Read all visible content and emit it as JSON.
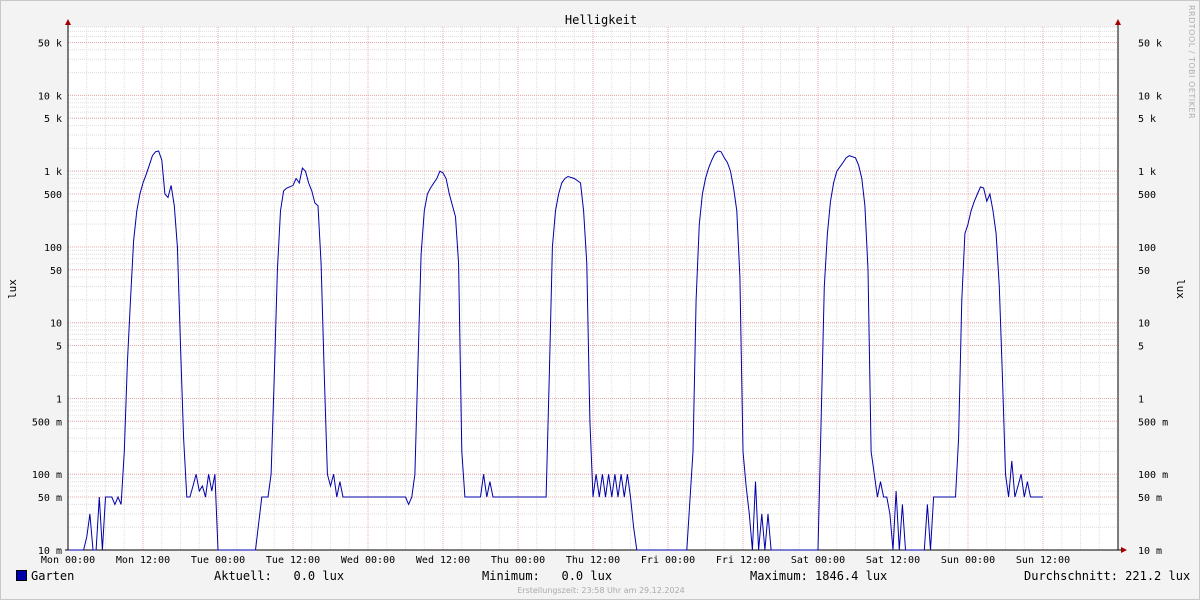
{
  "chart_data": {
    "type": "line",
    "title": "Helligkeit",
    "ylabel": "lux",
    "y_scale": "log",
    "ylim": [
      0.01,
      80000
    ],
    "y_ticks": [
      {
        "value": 0.01,
        "label": "10 m"
      },
      {
        "value": 0.05,
        "label": "50 m"
      },
      {
        "value": 0.1,
        "label": "100 m"
      },
      {
        "value": 0.5,
        "label": "500 m"
      },
      {
        "value": 1,
        "label": "1"
      },
      {
        "value": 5,
        "label": "5"
      },
      {
        "value": 10,
        "label": "10"
      },
      {
        "value": 50,
        "label": "50"
      },
      {
        "value": 100,
        "label": "100"
      },
      {
        "value": 500,
        "label": "500"
      },
      {
        "value": 1000,
        "label": "1 k"
      },
      {
        "value": 5000,
        "label": "5 k"
      },
      {
        "value": 10000,
        "label": "10 k"
      },
      {
        "value": 50000,
        "label": "50 k"
      }
    ],
    "x_ticks": [
      "Mon 00:00",
      "Mon 12:00",
      "Tue 00:00",
      "Tue 12:00",
      "Wed 00:00",
      "Wed 12:00",
      "Thu 00:00",
      "Thu 12:00",
      "Fri 00:00",
      "Fri 12:00",
      "Sat 00:00",
      "Sat 12:00",
      "Sun 00:00",
      "Sun 12:00"
    ],
    "x_unit": "hours since Mon 00:00",
    "xlim": [
      0,
      168
    ],
    "grid": true,
    "series": [
      {
        "name": "Garten",
        "color": "#0000aa",
        "points": [
          [
            0,
            0.01
          ],
          [
            1,
            0.01
          ],
          [
            2.5,
            0.01
          ],
          [
            3,
            0.015
          ],
          [
            3.5,
            0.03
          ],
          [
            4,
            0.01
          ],
          [
            4.5,
            0.01
          ],
          [
            5,
            0.05
          ],
          [
            5.5,
            0.01
          ],
          [
            6,
            0.05
          ],
          [
            7,
            0.05
          ],
          [
            7.5,
            0.04
          ],
          [
            8,
            0.05
          ],
          [
            8.5,
            0.04
          ],
          [
            9,
            0.2
          ],
          [
            9.5,
            3
          ],
          [
            10,
            20
          ],
          [
            10.5,
            120
          ],
          [
            11,
            300
          ],
          [
            11.5,
            500
          ],
          [
            12,
            700
          ],
          [
            12.5,
            900
          ],
          [
            13,
            1200
          ],
          [
            13.5,
            1600
          ],
          [
            14,
            1800
          ],
          [
            14.5,
            1846
          ],
          [
            15,
            1400
          ],
          [
            15.5,
            500
          ],
          [
            16,
            450
          ],
          [
            16.5,
            650
          ],
          [
            17,
            350
          ],
          [
            17.5,
            100
          ],
          [
            18,
            5
          ],
          [
            18.5,
            0.3
          ],
          [
            19,
            0.05
          ],
          [
            19.5,
            0.05
          ],
          [
            20,
            0.07
          ],
          [
            20.5,
            0.1
          ],
          [
            21,
            0.06
          ],
          [
            21.5,
            0.07
          ],
          [
            22,
            0.05
          ],
          [
            22.5,
            0.1
          ],
          [
            23,
            0.06
          ],
          [
            23.5,
            0.1
          ],
          [
            24,
            0.01
          ],
          [
            30,
            0.01
          ],
          [
            31,
            0.05
          ],
          [
            32,
            0.05
          ],
          [
            32.5,
            0.1
          ],
          [
            33,
            2
          ],
          [
            33.5,
            50
          ],
          [
            34,
            300
          ],
          [
            34.5,
            550
          ],
          [
            35,
            600
          ],
          [
            36,
            650
          ],
          [
            36.5,
            800
          ],
          [
            37,
            700
          ],
          [
            37.5,
            1100
          ],
          [
            38,
            1000
          ],
          [
            38.5,
            700
          ],
          [
            39,
            550
          ],
          [
            39.5,
            380
          ],
          [
            40,
            350
          ],
          [
            40.5,
            60
          ],
          [
            41,
            2
          ],
          [
            41.5,
            0.1
          ],
          [
            42,
            0.07
          ],
          [
            42.5,
            0.1
          ],
          [
            43,
            0.05
          ],
          [
            43.5,
            0.08
          ],
          [
            44,
            0.05
          ],
          [
            50,
            0.05
          ],
          [
            54,
            0.05
          ],
          [
            54.5,
            0.04
          ],
          [
            55,
            0.05
          ],
          [
            55.5,
            0.1
          ],
          [
            56,
            3
          ],
          [
            56.5,
            80
          ],
          [
            57,
            300
          ],
          [
            57.5,
            500
          ],
          [
            58,
            600
          ],
          [
            59,
            800
          ],
          [
            59.5,
            1000
          ],
          [
            60,
            950
          ],
          [
            60.5,
            800
          ],
          [
            61,
            500
          ],
          [
            62,
            250
          ],
          [
            62.5,
            60
          ],
          [
            63,
            0.2
          ],
          [
            63.5,
            0.05
          ],
          [
            66,
            0.05
          ],
          [
            66.5,
            0.1
          ],
          [
            67,
            0.05
          ],
          [
            67.5,
            0.08
          ],
          [
            68,
            0.05
          ],
          [
            72,
            0.05
          ],
          [
            76,
            0.05
          ],
          [
            76.5,
            0.05
          ],
          [
            77,
            2
          ],
          [
            77.5,
            100
          ],
          [
            78,
            300
          ],
          [
            78.5,
            500
          ],
          [
            79,
            700
          ],
          [
            79.5,
            800
          ],
          [
            80,
            850
          ],
          [
            81,
            800
          ],
          [
            82,
            700
          ],
          [
            82.5,
            300
          ],
          [
            83,
            60
          ],
          [
            83.5,
            0.5
          ],
          [
            84,
            0.05
          ],
          [
            84.5,
            0.1
          ],
          [
            85,
            0.05
          ],
          [
            85.5,
            0.1
          ],
          [
            86,
            0.05
          ],
          [
            86.5,
            0.1
          ],
          [
            87,
            0.05
          ],
          [
            87.5,
            0.1
          ],
          [
            88,
            0.05
          ],
          [
            88.5,
            0.1
          ],
          [
            89,
            0.05
          ],
          [
            89.5,
            0.1
          ],
          [
            90,
            0.05
          ],
          [
            90.5,
            0.02
          ],
          [
            91,
            0.01
          ],
          [
            99,
            0.01
          ],
          [
            100,
            0.2
          ],
          [
            100.5,
            20
          ],
          [
            101,
            200
          ],
          [
            101.5,
            500
          ],
          [
            102,
            800
          ],
          [
            102.5,
            1100
          ],
          [
            103,
            1400
          ],
          [
            103.5,
            1700
          ],
          [
            104,
            1846
          ],
          [
            104.5,
            1800
          ],
          [
            105,
            1500
          ],
          [
            105.5,
            1300
          ],
          [
            106,
            1000
          ],
          [
            106.5,
            600
          ],
          [
            107,
            300
          ],
          [
            107.5,
            40
          ],
          [
            108,
            0.2
          ],
          [
            108.5,
            0.07
          ],
          [
            109,
            0.03
          ],
          [
            109.5,
            0.01
          ],
          [
            110,
            0.08
          ],
          [
            110.5,
            0.01
          ],
          [
            111,
            0.03
          ],
          [
            111.5,
            0.01
          ],
          [
            112,
            0.03
          ],
          [
            112.5,
            0.01
          ],
          [
            120,
            0.01
          ],
          [
            120.5,
            0.5
          ],
          [
            121,
            30
          ],
          [
            121.5,
            150
          ],
          [
            122,
            400
          ],
          [
            122.5,
            700
          ],
          [
            123,
            1000
          ],
          [
            124,
            1300
          ],
          [
            124.5,
            1500
          ],
          [
            125,
            1600
          ],
          [
            126,
            1500
          ],
          [
            126.5,
            1200
          ],
          [
            127,
            800
          ],
          [
            127.5,
            350
          ],
          [
            128,
            50
          ],
          [
            128.5,
            0.2
          ],
          [
            129,
            0.1
          ],
          [
            129.5,
            0.05
          ],
          [
            130,
            0.08
          ],
          [
            130.5,
            0.05
          ],
          [
            131,
            0.05
          ],
          [
            131.5,
            0.03
          ],
          [
            132,
            0.01
          ],
          [
            132.5,
            0.06
          ],
          [
            133,
            0.01
          ],
          [
            133.5,
            0.04
          ],
          [
            134,
            0.01
          ],
          [
            137,
            0.01
          ],
          [
            137.5,
            0.04
          ],
          [
            138,
            0.01
          ],
          [
            138.5,
            0.05
          ],
          [
            142,
            0.05
          ],
          [
            142.5,
            0.3
          ],
          [
            143,
            20
          ],
          [
            143.5,
            150
          ],
          [
            144,
            200
          ],
          [
            144.5,
            300
          ],
          [
            145,
            400
          ],
          [
            145.5,
            500
          ],
          [
            146,
            620
          ],
          [
            146.5,
            600
          ],
          [
            147,
            400
          ],
          [
            147.5,
            500
          ],
          [
            148,
            300
          ],
          [
            148.5,
            150
          ],
          [
            149,
            30
          ],
          [
            149.5,
            2
          ],
          [
            150,
            0.1
          ],
          [
            150.5,
            0.05
          ],
          [
            151,
            0.15
          ],
          [
            151.5,
            0.05
          ],
          [
            152,
            0.07
          ],
          [
            152.5,
            0.1
          ],
          [
            153,
            0.05
          ],
          [
            153.5,
            0.08
          ],
          [
            154,
            0.05
          ],
          [
            156,
            0.05
          ]
        ]
      }
    ]
  },
  "watermark": "RRDTOOL / TOBI OETIKER",
  "legend": {
    "swatch_color": "#0000aa",
    "name": "Garten",
    "current_label": "Aktuell:",
    "current_value": "0.0 lux",
    "min_label": "Minimum:",
    "min_value": "0.0 lux",
    "max_label": "Maximum:",
    "max_value": "1846.4 lux",
    "avg_label": "Durchschnitt:",
    "avg_value": "221.2 lux"
  },
  "footer": "Erstellungszeit: 23:58 Uhr am 29.12.2024"
}
